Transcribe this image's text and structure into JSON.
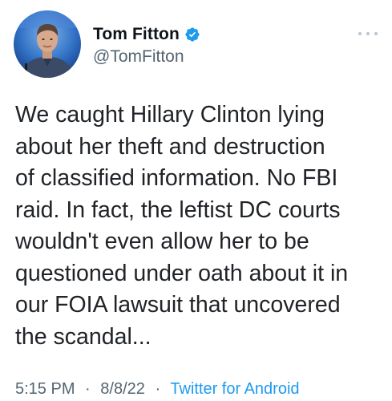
{
  "author": {
    "display_name": "Tom Fitton",
    "handle": "@TomFitton",
    "verified_icon": "verified-badge-icon",
    "avatar_icon": "profile-photo"
  },
  "tweet": {
    "lines": [
      "We caught Hillary Clinton lying",
      "about her theft and destruction",
      "of classified information. No FBI",
      "raid. In fact, the leftist DC courts",
      "wouldn't even allow her to be",
      "questioned under oath about it in",
      "our FOIA lawsuit that uncovered",
      "the scandal..."
    ]
  },
  "meta": {
    "time": "5:15 PM",
    "separator": "·",
    "date": "8/8/22",
    "source": "Twitter for Android"
  },
  "colors": {
    "text": "#0f1419",
    "secondary": "#536471",
    "link": "#1d9bf0",
    "verified": "#1d9bf0"
  }
}
